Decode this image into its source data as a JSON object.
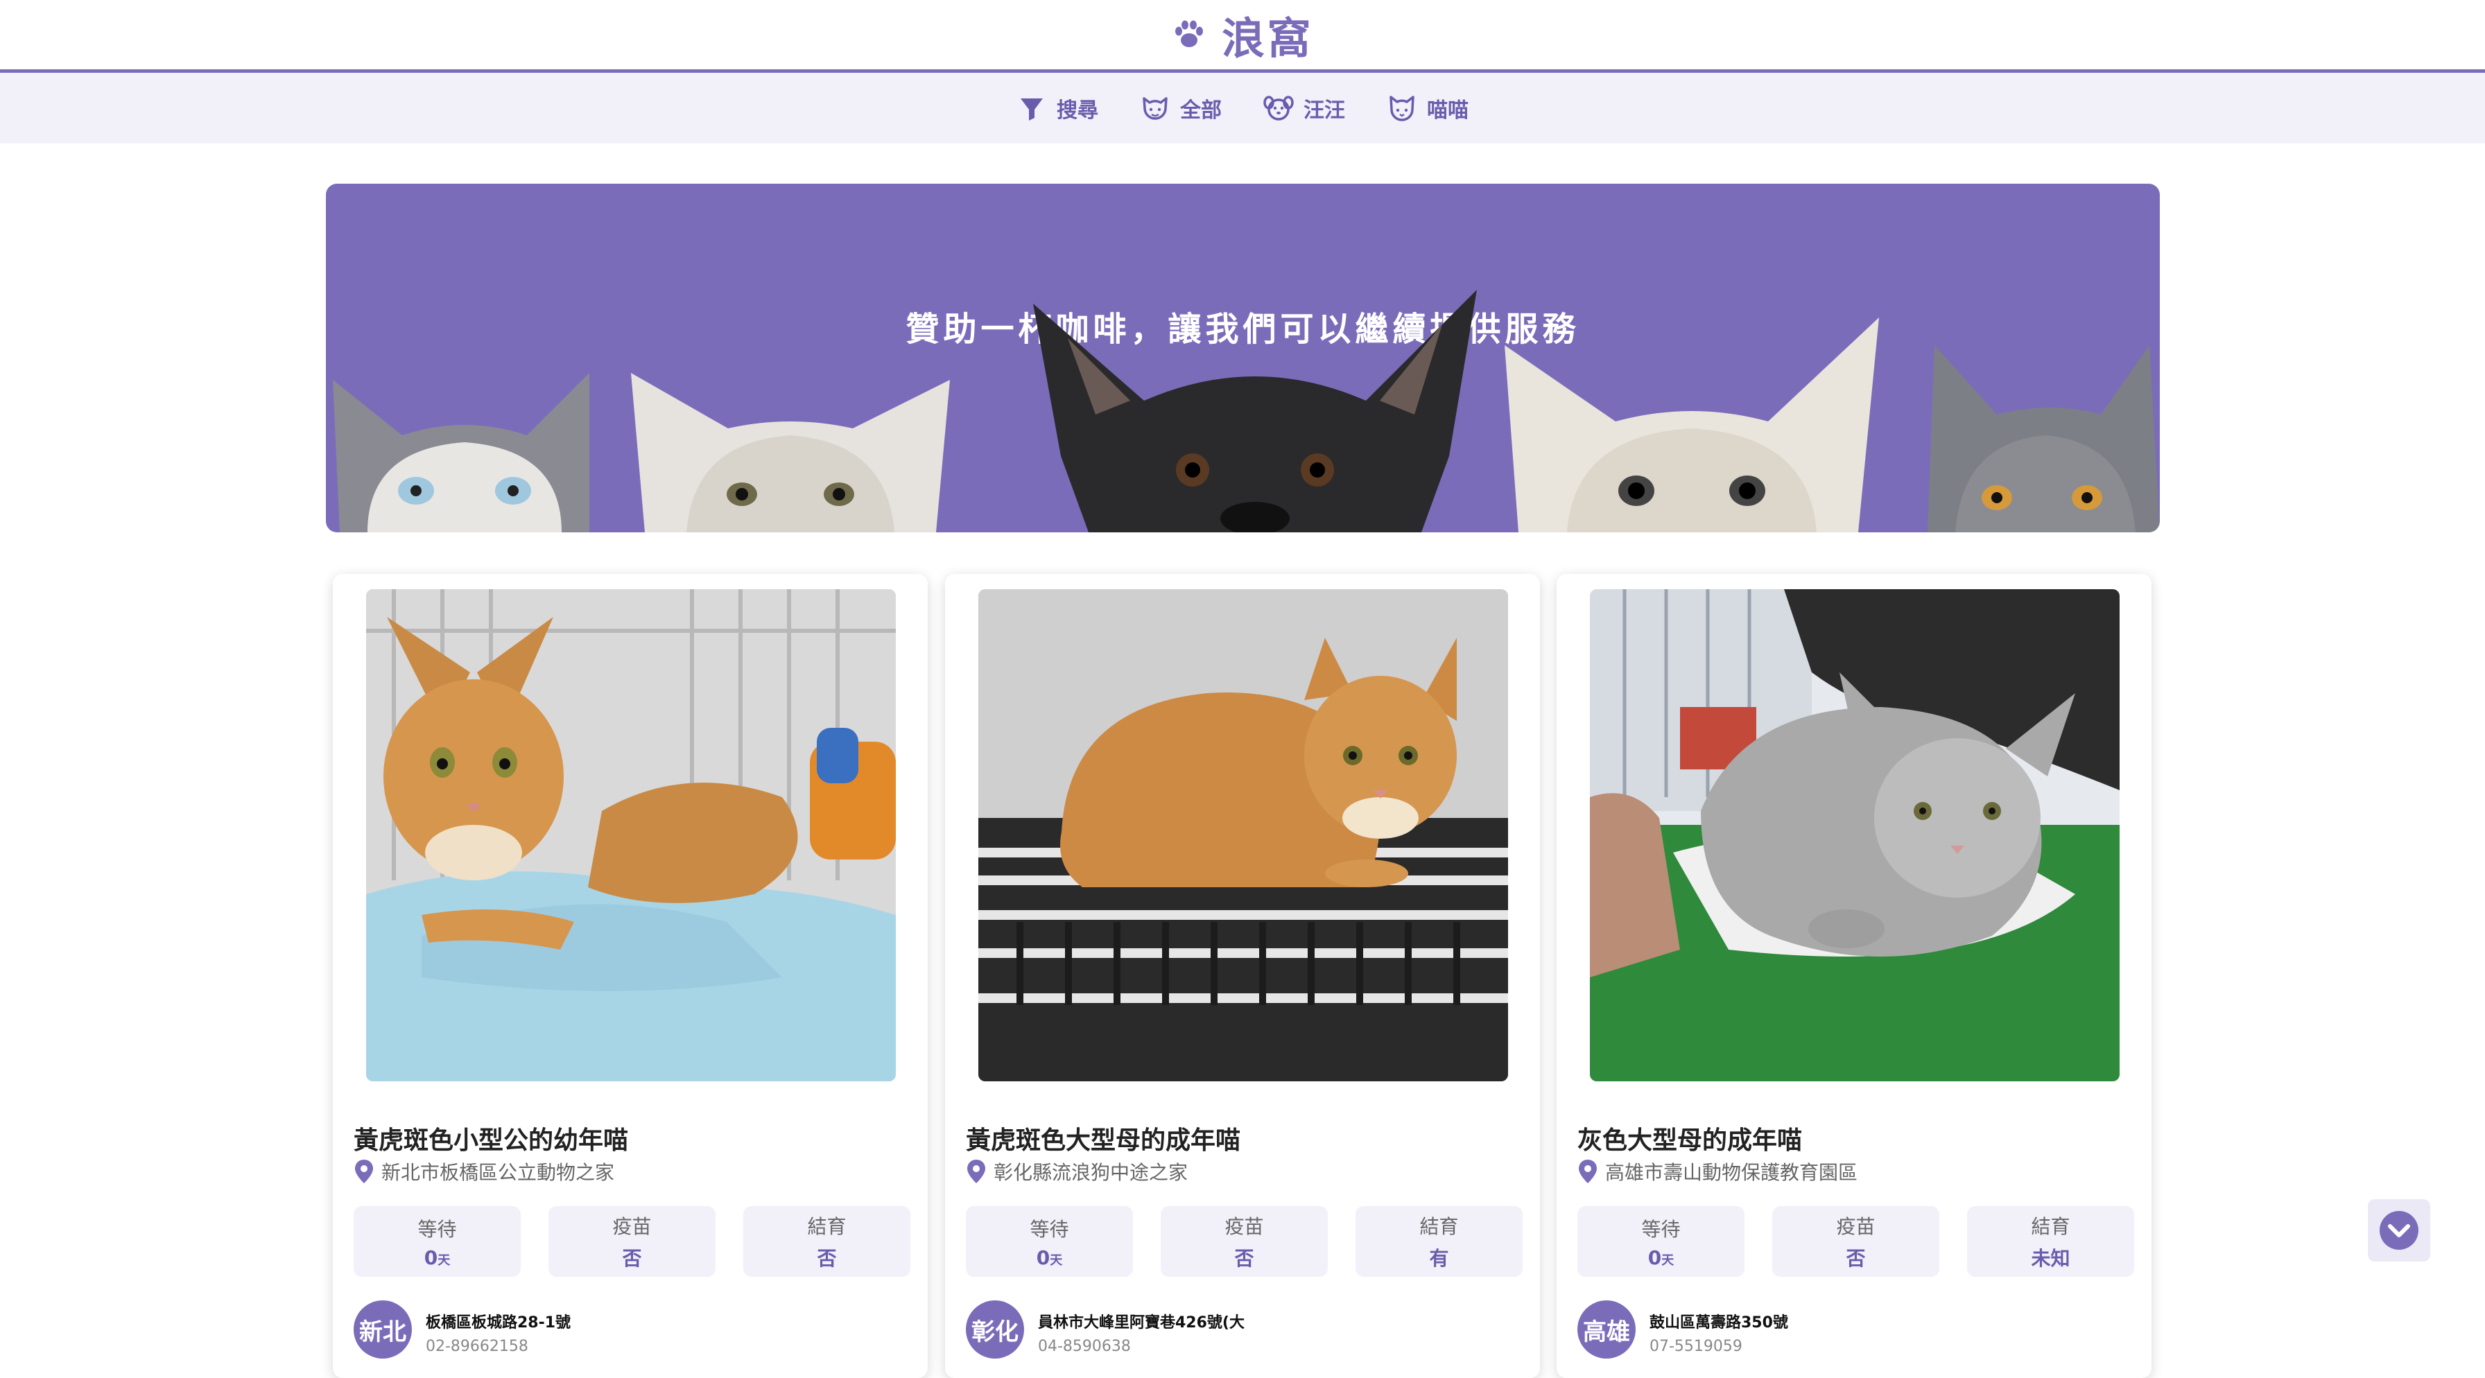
{
  "header": {
    "title": "浪窩",
    "logo_icon": "paw-icon"
  },
  "nav": {
    "items": [
      {
        "label": "搜尋",
        "icon": "filter-icon"
      },
      {
        "label": "全部",
        "icon": "pet-face-icon"
      },
      {
        "label": "汪汪",
        "icon": "dog-face-icon"
      },
      {
        "label": "喵喵",
        "icon": "cat-face-icon"
      }
    ]
  },
  "banner": {
    "text": "贊助一杯咖啡，讓我們可以繼續提供服務"
  },
  "colors": {
    "accent": "#7b6cba",
    "accent_light": "#f2f0f9",
    "text_accent": "#6a5cad"
  },
  "cards": [
    {
      "title": "黃虎斑色小型公的幼年喵",
      "location": "新北市板橋區公立動物之家",
      "stats": [
        {
          "label": "等待",
          "value": "0",
          "unit": "天"
        },
        {
          "label": "疫苗",
          "value": "否",
          "unit": ""
        },
        {
          "label": "結育",
          "value": "否",
          "unit": ""
        }
      ],
      "region": "新北",
      "address": "板橋區板城路28-1號",
      "phone": "02-89662158"
    },
    {
      "title": "黃虎斑色大型母的成年喵",
      "location": "彰化縣流浪狗中途之家",
      "stats": [
        {
          "label": "等待",
          "value": "0",
          "unit": "天"
        },
        {
          "label": "疫苗",
          "value": "否",
          "unit": ""
        },
        {
          "label": "結育",
          "value": "有",
          "unit": ""
        }
      ],
      "region": "彰化",
      "address": "員林市大峰里阿寶巷426號(大",
      "phone": "04-8590638"
    },
    {
      "title": "灰色大型母的成年喵",
      "location": "高雄市壽山動物保護教育園區",
      "stats": [
        {
          "label": "等待",
          "value": "0",
          "unit": "天"
        },
        {
          "label": "疫苗",
          "value": "否",
          "unit": ""
        },
        {
          "label": "結育",
          "value": "未知",
          "unit": ""
        }
      ],
      "region": "高雄",
      "address": "鼓山區萬壽路350號",
      "phone": "07-5519059"
    }
  ],
  "scroll_button": {
    "icon": "chevron-down-circle-icon"
  }
}
